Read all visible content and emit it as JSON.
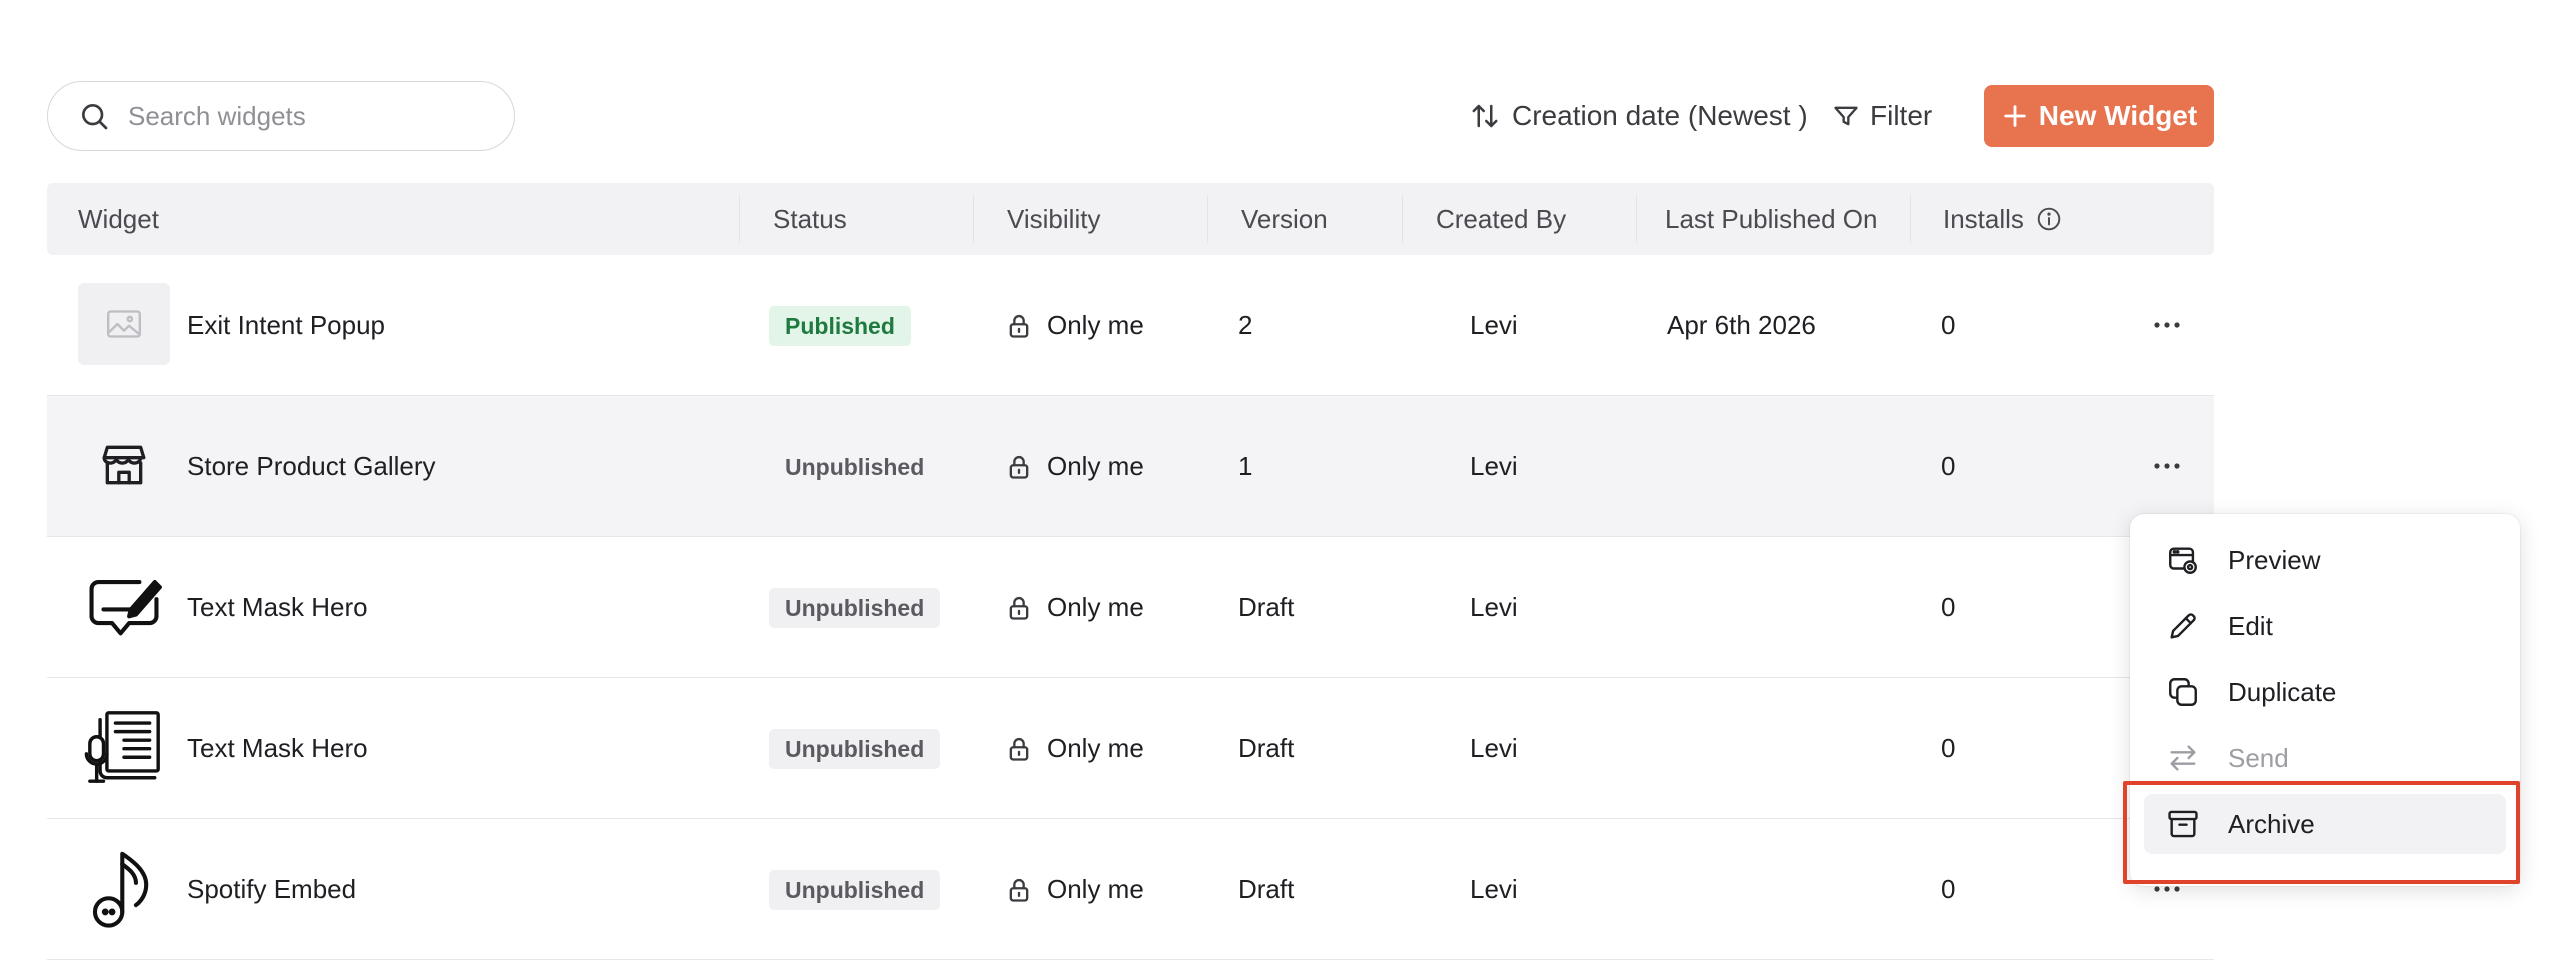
{
  "search": {
    "placeholder": "Search widgets"
  },
  "toolbar": {
    "sort_label": "Creation date (Newest )",
    "filter_label": "Filter",
    "new_widget_label": "New Widget"
  },
  "columns": {
    "widget": "Widget",
    "status": "Status",
    "visibility": "Visibility",
    "version": "Version",
    "created_by": "Created By",
    "last_published_on": "Last Published On",
    "installs": "Installs"
  },
  "rows": [
    {
      "name": "Exit Intent Popup",
      "icon": "image-placeholder-icon",
      "status": "Published",
      "visibility": "Only me",
      "version": "2",
      "created_by": "Levi",
      "last_published": "Apr 6th 2026",
      "installs": "0"
    },
    {
      "name": "Store Product Gallery",
      "icon": "store-icon",
      "status": "Unpublished",
      "visibility": "Only me",
      "version": "1",
      "created_by": "Levi",
      "last_published": "",
      "installs": "0"
    },
    {
      "name": "Text Mask Hero",
      "icon": "chat-edit-icon",
      "status": "Unpublished",
      "visibility": "Only me",
      "version": "Draft",
      "created_by": "Levi",
      "last_published": "",
      "installs": "0"
    },
    {
      "name": "Text Mask Hero",
      "icon": "newspaper-mic-icon",
      "status": "Unpublished",
      "visibility": "Only me",
      "version": "Draft",
      "created_by": "Levi",
      "last_published": "",
      "installs": "0"
    },
    {
      "name": "Spotify Embed",
      "icon": "music-note-icon",
      "status": "Unpublished",
      "visibility": "Only me",
      "version": "Draft",
      "created_by": "Levi",
      "last_published": "",
      "installs": "0"
    }
  ],
  "context_menu": {
    "items": [
      {
        "label": "Preview",
        "icon": "preview-icon",
        "state": "enabled"
      },
      {
        "label": "Edit",
        "icon": "pencil-icon",
        "state": "enabled"
      },
      {
        "label": "Duplicate",
        "icon": "duplicate-icon",
        "state": "enabled"
      },
      {
        "label": "Send",
        "icon": "send-arrows-icon",
        "state": "disabled"
      },
      {
        "label": "Archive",
        "icon": "archive-icon",
        "state": "hovered"
      }
    ]
  },
  "colors": {
    "accent": "#e8734f",
    "published_bg": "#e3f5e8",
    "published_text": "#1f7a3f",
    "highlight": "#e0432c"
  }
}
